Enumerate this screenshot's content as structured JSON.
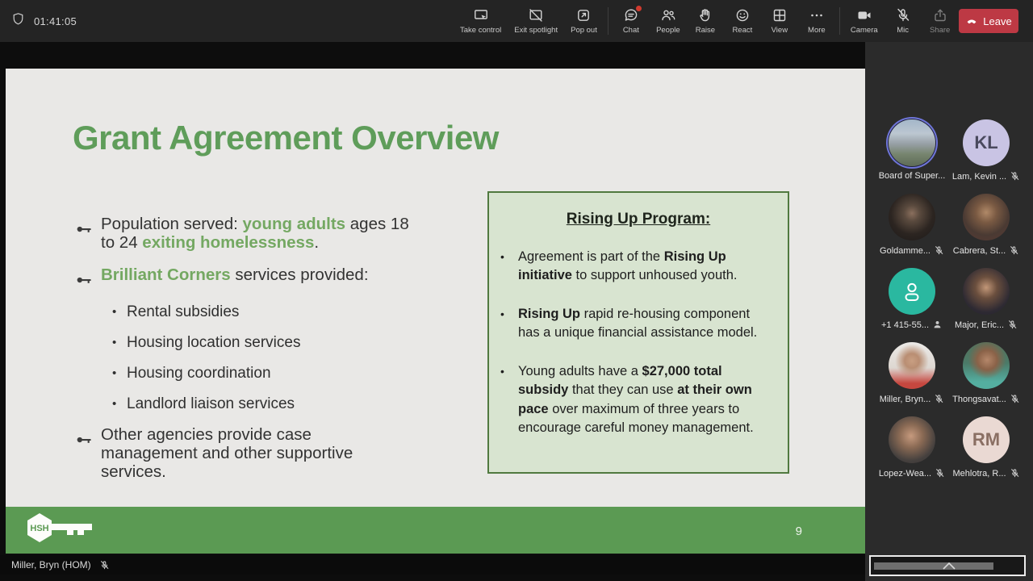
{
  "meeting": {
    "timer": "01:41:05",
    "leave_label": "Leave",
    "presenter_label": "Miller, Bryn (HOM)",
    "accent_colors": {
      "leave_red": "#bd3944",
      "chat_badge": "#d13a2e",
      "speaking_ring": "#6f76d9"
    },
    "toolbar_buttons": [
      {
        "label": "Take control",
        "icon": "take-control"
      },
      {
        "label": "Exit spotlight",
        "icon": "exit-spotlight"
      },
      {
        "label": "Pop out",
        "icon": "pop-out",
        "group_end": true
      },
      {
        "label": "Chat",
        "icon": "chat",
        "badge": true
      },
      {
        "label": "People",
        "icon": "people"
      },
      {
        "label": "Raise",
        "icon": "raise"
      },
      {
        "label": "React",
        "icon": "react"
      },
      {
        "label": "View",
        "icon": "view"
      },
      {
        "label": "More",
        "icon": "more",
        "group_end": true
      },
      {
        "label": "Camera",
        "icon": "camera"
      },
      {
        "label": "Mic",
        "icon": "mic-off"
      },
      {
        "label": "Share",
        "icon": "share",
        "dim": true
      }
    ]
  },
  "slide": {
    "title": "Grant Agreement Overview",
    "title_color": "#5f9d5a",
    "footer_green": "#5b9a53",
    "page_number": "9",
    "logo_text": "HSH",
    "bullets": [
      {
        "level": 0,
        "segments": [
          {
            "t": "Population served: "
          },
          {
            "t": "young adults",
            "em": true
          },
          {
            "t": " ages 18\nto 24 "
          },
          {
            "t": "exiting homelessness",
            "em": true
          },
          {
            "t": "."
          }
        ]
      },
      {
        "level": 0,
        "segments": [
          {
            "t": "Brilliant Corners",
            "em": true
          },
          {
            "t": " services provided:"
          }
        ]
      },
      {
        "level": 1,
        "segments": [
          {
            "t": "Rental subsidies"
          }
        ]
      },
      {
        "level": 1,
        "segments": [
          {
            "t": "Housing location services"
          }
        ]
      },
      {
        "level": 1,
        "segments": [
          {
            "t": "Housing coordination"
          }
        ]
      },
      {
        "level": 1,
        "segments": [
          {
            "t": "Landlord liaison services"
          }
        ]
      },
      {
        "level": 0,
        "segments": [
          {
            "t": "Other agencies provide case\nmanagement and other supportive\nservices."
          }
        ]
      }
    ],
    "callout": {
      "title": "Rising Up Program:",
      "bg": "#d8e4d0",
      "border": "#50793f",
      "bullets": [
        {
          "segments": [
            {
              "t": "Agreement is part of the "
            },
            {
              "t": "Rising Up\ninitiative",
              "b": true
            },
            {
              "t": " to support unhoused youth."
            }
          ]
        },
        {
          "segments": [
            {
              "t": "Rising Up",
              "b": true
            },
            {
              "t": " rapid re-housing component\nhas a unique financial assistance model."
            }
          ]
        },
        {
          "segments": [
            {
              "t": "Young adults have a "
            },
            {
              "t": "$27,000 total\nsubsidy",
              "b": true
            },
            {
              "t": " that they can use "
            },
            {
              "t": "at their own\npace",
              "b": true
            },
            {
              "t": " over maximum of three years to\nencourage careful money management."
            }
          ]
        }
      ]
    }
  },
  "participants": [
    {
      "name": "Board of Super...",
      "avatar_style": "cityhall",
      "speaking": true,
      "muted": false
    },
    {
      "name": "Lam, Kevin ...",
      "avatar_style": "initials",
      "initials": "KL",
      "bg": "#c9c4e4",
      "fg": "#4a4a5e",
      "muted": true
    },
    {
      "name": "Goldamme...",
      "avatar_style": "goldammer",
      "muted": true
    },
    {
      "name": "Cabrera, St...",
      "avatar_style": "cabrera",
      "muted": true
    },
    {
      "name": "+1 415-55...",
      "avatar_style": "phone",
      "bg": "#2ab8a0",
      "muted": false,
      "phone_user": true
    },
    {
      "name": "Major, Eric...",
      "avatar_style": "major",
      "muted": true
    },
    {
      "name": "Miller, Bryn...",
      "avatar_style": "miller",
      "muted": true
    },
    {
      "name": "Thongsavat...",
      "avatar_style": "thongsavat",
      "muted": true
    },
    {
      "name": "Lopez-Wea...",
      "avatar_style": "lopez",
      "muted": true
    },
    {
      "name": "Mehlotra, R...",
      "avatar_style": "initials",
      "initials": "RM",
      "bg": "#ead9d3",
      "fg": "#8a6f63",
      "muted": true
    }
  ]
}
